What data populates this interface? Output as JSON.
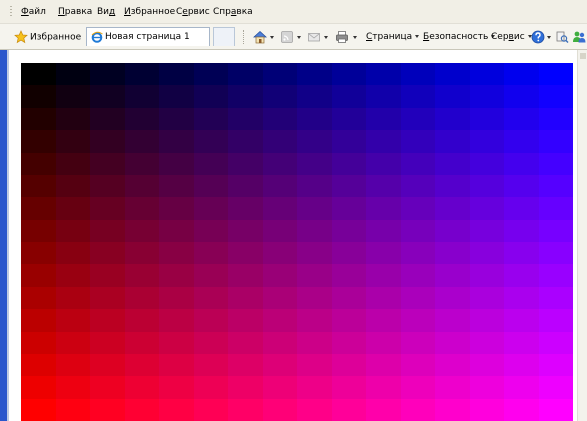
{
  "menu": [
    {
      "prefix": "",
      "key": "Ф",
      "rest": "айл"
    },
    {
      "prefix": "",
      "key": "П",
      "rest": "равка"
    },
    {
      "prefix": "Ви",
      "key": "д",
      "rest": ""
    },
    {
      "prefix": "",
      "key": "И",
      "rest": "збранное"
    },
    {
      "prefix": "С",
      "key": "е",
      "rest": "рвис"
    },
    {
      "prefix": "Спр",
      "key": "а",
      "rest": "вка"
    }
  ],
  "toolbar": {
    "favorites_label": "Избранное",
    "tab_title": "Новая страница 1",
    "page_label": {
      "prefix": "",
      "key": "С",
      "rest": "траница"
    },
    "security_label": {
      "prefix": "",
      "key": "Б",
      "rest": "езопасность"
    },
    "tools_label": {
      "prefix": "Сер",
      "key": "в",
      "rest": "ис"
    }
  },
  "icons": [
    "star-icon",
    "ie-icon",
    "home-icon",
    "feeds-icon",
    "mail-icon",
    "print-icon",
    "help-icon",
    "research-icon",
    "messenger-icon"
  ],
  "colors": {
    "frame_blue": "#2a56cc",
    "grid_top_left": "#000000",
    "grid_top_right": "#0000ff",
    "grid_bottom_left": "#ff0000",
    "grid_bottom_right": "#ff00ff"
  },
  "grid": {
    "rows": 16,
    "cols": 16
  }
}
